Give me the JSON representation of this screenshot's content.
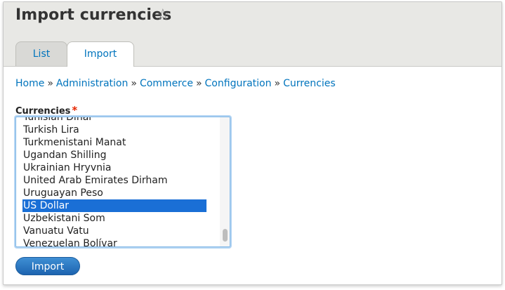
{
  "page": {
    "title": "Import currencies"
  },
  "icons": {
    "favorite": "star-outline-icon"
  },
  "tabs": [
    {
      "label": "List",
      "active": false
    },
    {
      "label": "Import",
      "active": true
    }
  ],
  "breadcrumb": {
    "separator": "»",
    "items": [
      "Home",
      "Administration",
      "Commerce",
      "Configuration",
      "Currencies"
    ]
  },
  "form": {
    "currencies_label": "Currencies",
    "required_marker": "*",
    "options": [
      "Tunisian Dinar",
      "Turkish Lira",
      "Turkmenistani Manat",
      "Ugandan Shilling",
      "Ukrainian Hryvnia",
      "United Arab Emirates Dirham",
      "Uruguayan Peso",
      "US Dollar",
      "Uzbekistani Som",
      "Vanuatu Vatu",
      "Venezuelan Bolívar"
    ],
    "selected": "US Dollar",
    "submit_label": "Import"
  },
  "colors": {
    "link": "#0074bd",
    "selection": "#1a6fd6",
    "button": "#1d64b0",
    "required": "#e62600"
  }
}
